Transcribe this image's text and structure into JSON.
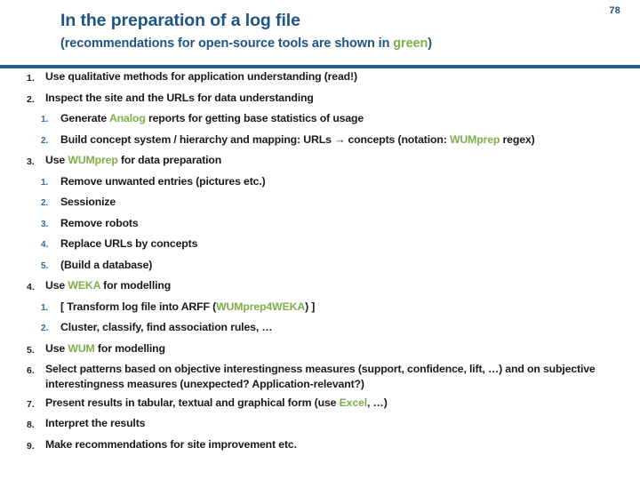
{
  "slide": {
    "page_number": "78",
    "title": "In the preparation of a log file",
    "subtitle_prefix": "(recommendations for open-source tools are shown in ",
    "subtitle_highlight": "green",
    "subtitle_suffix": ")",
    "accent_blue": "#1f5486",
    "rule_blue": "#245d92",
    "highlight_green": "#7daf4a",
    "sub_number_blue": "#2e6ca4"
  },
  "items": [
    {
      "num": "1.",
      "segments": [
        {
          "text": "Use qualitative methods for application understanding (read!)",
          "green": false
        }
      ],
      "subitems": []
    },
    {
      "num": "2.",
      "segments": [
        {
          "text": "Inspect the site and the URLs for data understanding",
          "green": false
        }
      ],
      "subitems": [
        {
          "num": "1.",
          "segments": [
            {
              "text": "Generate ",
              "green": false
            },
            {
              "text": "Analog",
              "green": true
            },
            {
              "text": " reports for getting base statistics of usage",
              "green": false
            }
          ]
        },
        {
          "num": "2.",
          "segments": [
            {
              "text": "Build concept system / hierarchy and mapping: URLs → concepts (notation: ",
              "green": false
            },
            {
              "text": "WUMprep",
              "green": true
            },
            {
              "text": " regex)",
              "green": false
            }
          ]
        }
      ]
    },
    {
      "num": "3.",
      "segments": [
        {
          "text": "Use ",
          "green": false
        },
        {
          "text": "WUMprep",
          "green": true
        },
        {
          "text": " for data preparation",
          "green": false
        }
      ],
      "subitems": [
        {
          "num": "1.",
          "segments": [
            {
              "text": "Remove unwanted entries (pictures etc.)",
              "green": false
            }
          ]
        },
        {
          "num": "2.",
          "segments": [
            {
              "text": "Sessionize",
              "green": false
            }
          ]
        },
        {
          "num": "3.",
          "segments": [
            {
              "text": "Remove robots",
              "green": false
            }
          ]
        },
        {
          "num": "4.",
          "segments": [
            {
              "text": "Replace URLs by concepts",
              "green": false
            }
          ]
        },
        {
          "num": "5.",
          "segments": [
            {
              "text": "(Build a database)",
              "green": false
            }
          ]
        }
      ]
    },
    {
      "num": "4.",
      "segments": [
        {
          "text": "Use ",
          "green": false
        },
        {
          "text": "WEKA",
          "green": true
        },
        {
          "text": " for modelling",
          "green": false
        }
      ],
      "subitems": [
        {
          "num": "1.",
          "segments": [
            {
              "text": "[ Transform log file into ARFF (",
              "green": false
            },
            {
              "text": "WUMprep4WEKA",
              "green": true
            },
            {
              "text": ") ]",
              "green": false
            }
          ]
        },
        {
          "num": "2.",
          "segments": [
            {
              "text": "Cluster, classify, find association rules, …",
              "green": false
            }
          ]
        }
      ]
    },
    {
      "num": "5.",
      "segments": [
        {
          "text": "Use ",
          "green": false
        },
        {
          "text": "WUM",
          "green": true
        },
        {
          "text": " for modelling",
          "green": false
        }
      ],
      "subitems": []
    },
    {
      "num": "6.",
      "segments": [
        {
          "text": "Select patterns based on objective interestingness measures (support, confidence, lift, …) and on subjective interestingness measures (unexpected? Application-relevant?)",
          "green": false
        }
      ],
      "subitems": []
    },
    {
      "num": "7.",
      "segments": [
        {
          "text": "Present results in tabular, textual and graphical form (use ",
          "green": false
        },
        {
          "text": "Excel",
          "green": true
        },
        {
          "text": ", …)",
          "green": false
        }
      ],
      "subitems": []
    },
    {
      "num": "8.",
      "segments": [
        {
          "text": "Interpret the results",
          "green": false
        }
      ],
      "subitems": []
    },
    {
      "num": "9.",
      "segments": [
        {
          "text": "Make recommendations for site improvement etc.",
          "green": false
        }
      ],
      "subitems": []
    }
  ]
}
